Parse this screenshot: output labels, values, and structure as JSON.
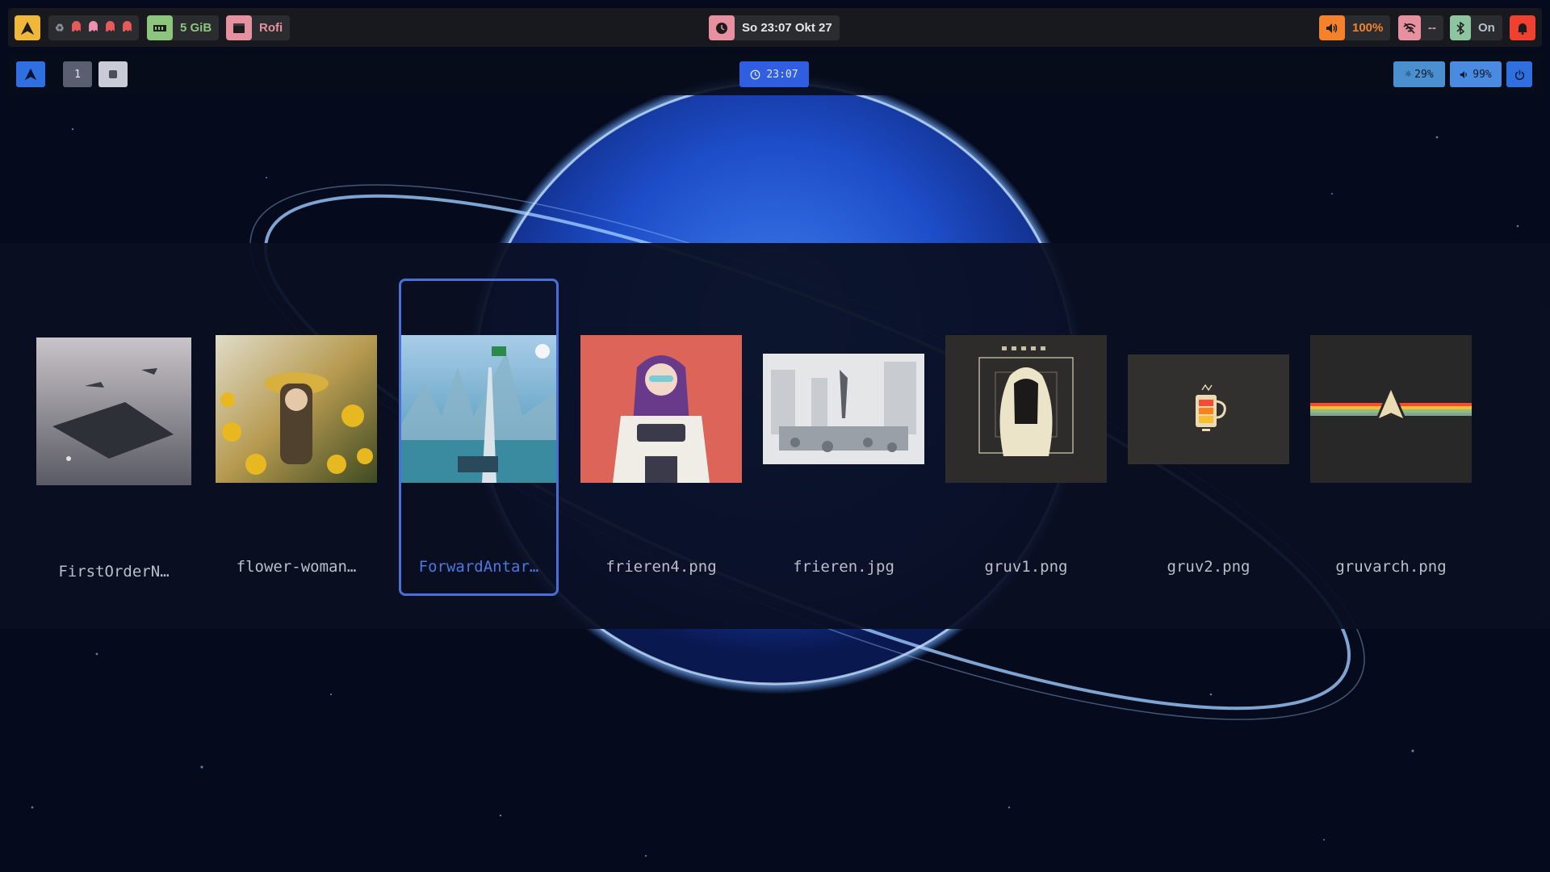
{
  "topbar": {
    "launcher_icon": "arch-logo-icon",
    "tray_icons": [
      "recycle-icon",
      "ghost-icon",
      "ghost-icon",
      "ghost-icon",
      "ghost-icon"
    ],
    "memory": {
      "icon": "memory-icon",
      "label": "5 GiB"
    },
    "window": {
      "icon": "window-icon",
      "label": "Rofi"
    },
    "clock": {
      "icon": "clock-icon",
      "label": "So 23:07 Okt 27"
    },
    "volume": {
      "icon": "speaker-icon",
      "label": "100%"
    },
    "wifi": {
      "icon": "wifi-off-icon",
      "label": "--"
    },
    "bluetooth": {
      "icon": "bluetooth-icon",
      "label": "On"
    },
    "notifications": {
      "icon": "bell-icon"
    }
  },
  "bar2": {
    "workspace_1": "1",
    "clock": "23:07",
    "brightness": "29%",
    "volume": "99%"
  },
  "rofi": {
    "selected_index": 2,
    "items": [
      {
        "label": "FirstOrderN…"
      },
      {
        "label": "flower-woman…"
      },
      {
        "label": "ForwardAntar…"
      },
      {
        "label": "frieren4.png"
      },
      {
        "label": "frieren.jpg"
      },
      {
        "label": "gruv1.png"
      },
      {
        "label": "gruv2.png"
      },
      {
        "label": "gruvarch.png"
      }
    ]
  },
  "colors": {
    "accent": "#4a70d8",
    "launcher": "#f0b83a",
    "memory": "#8cc57c",
    "window": "#e790a0",
    "volume": "#f5822a",
    "alert": "#ef4030"
  }
}
